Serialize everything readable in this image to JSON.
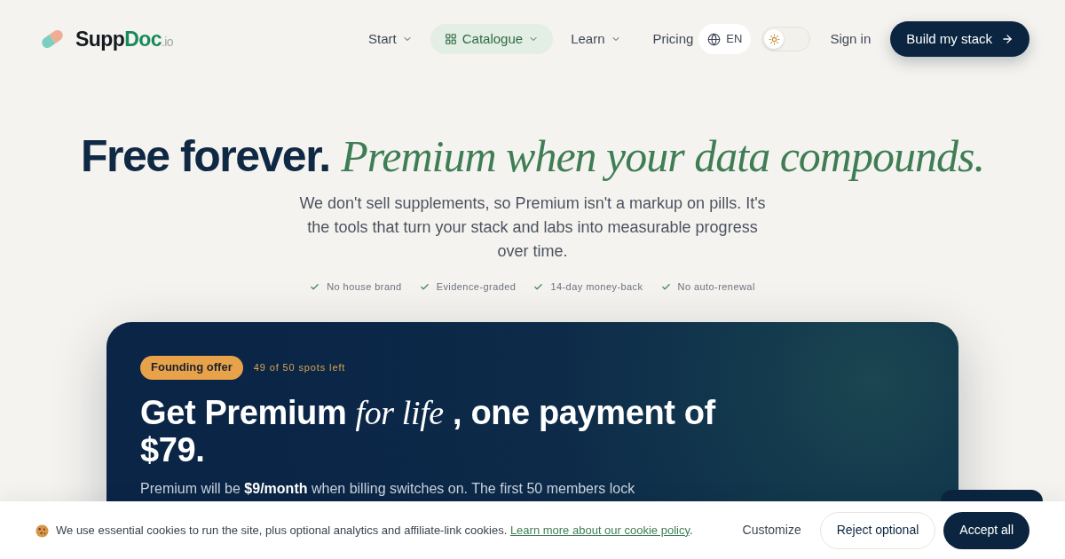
{
  "nav": {
    "logo": {
      "lead": "Supp",
      "accent": "Doc",
      "suffix": ".io"
    },
    "items": [
      {
        "label": "Start",
        "kind": "dropdown",
        "selected": false
      },
      {
        "label": "Catalogue",
        "kind": "catalog",
        "selected": true
      },
      {
        "label": "Learn",
        "kind": "dropdown",
        "selected": false
      },
      {
        "label": "Pricing",
        "kind": "link",
        "selected": false
      }
    ],
    "language": "EN",
    "theme_toggle": {
      "dark": false
    },
    "sign_in": "Sign in",
    "cta": "Build my stack"
  },
  "hero": {
    "title": "Free forever. *Premium when your data compounds.*",
    "subtitle": "We don't sell supplements, so Premium isn't a markup on pills. It's the tools that turn your stack and labs into measurable progress over time.",
    "features": [
      "No house brand",
      "Evidence-graded",
      "14-day money-back",
      "No auto-renewal"
    ]
  },
  "offer": {
    "badge": "Founding offer",
    "spots": "49 of 50 spots left",
    "title": "Get Premium *for life* , one payment of $79.",
    "body": "Premium will be **$9/month** when billing switches on. The first 50 members lock"
  },
  "cookie_banner": {
    "text": "We use essential cookies to run the site, plus optional analytics and affiliate-link cookies.",
    "link": "Learn more about our cookie policy",
    "link_suffix": ".",
    "buttons": [
      {
        "label": "Customize",
        "kind": "text"
      },
      {
        "label": "Reject optional",
        "kind": "outline"
      },
      {
        "label": "Accept all",
        "kind": "primary"
      }
    ]
  }
}
